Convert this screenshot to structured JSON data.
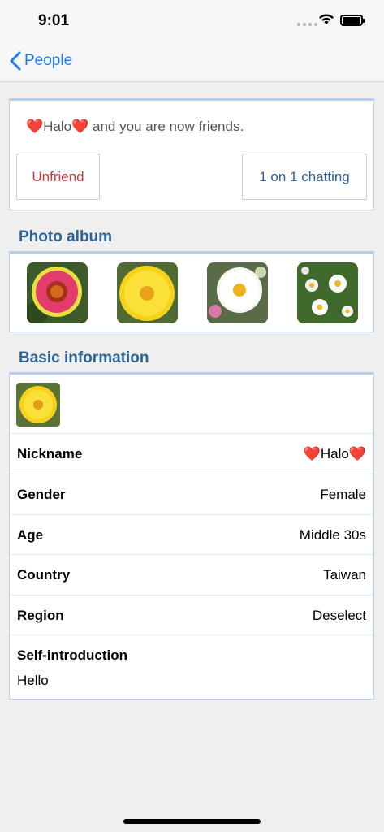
{
  "status": {
    "time": "9:01"
  },
  "nav": {
    "back_label": "People"
  },
  "friend": {
    "name": "❤️Halo❤️",
    "message": " and you are now friends.",
    "unfriend_label": "Unfriend",
    "chat_label": "1 on 1 chatting"
  },
  "album": {
    "title": "Photo album",
    "photos": [
      "gaillardia-flower-photo",
      "yellow-coreopsis-photo",
      "white-daisy-photo",
      "small-daisies-photo"
    ]
  },
  "info": {
    "title": "Basic information",
    "avatar": "yellow-flower-avatar",
    "rows": [
      {
        "label": "Nickname",
        "value": "❤️Halo❤️"
      },
      {
        "label": "Gender",
        "value": "Female"
      },
      {
        "label": "Age",
        "value": "Middle 30s"
      },
      {
        "label": "Country",
        "value": "Taiwan"
      },
      {
        "label": "Region",
        "value": "Deselect"
      }
    ],
    "intro_label": "Self-introduction",
    "intro_value": "Hello"
  },
  "colors": {
    "accent": "#1a7cf0",
    "section_title": "#2e6497",
    "unfriend": "#c93a3a",
    "chat": "#2e5f8f",
    "card_border": "#b3cff0"
  }
}
